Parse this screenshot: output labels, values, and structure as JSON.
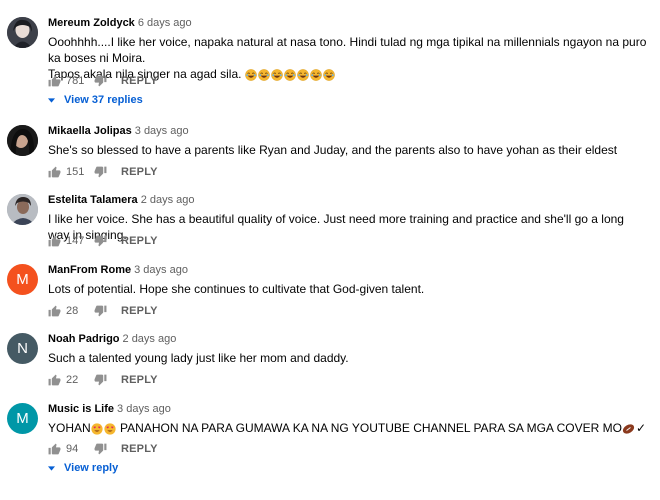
{
  "comments": [
    {
      "author": "Mereum Zoldyck",
      "time": "6 days ago",
      "text": "Ooohhhh....I like her voice, napaka natural at nasa tono. Hindi tulad ng mga tipikal na millennials ngayon na puro ka boses ni Moira.",
      "text2": "Tapos akala nila singer na agad sila.",
      "emoji_count": 7,
      "likes": "781",
      "reply_label": "REPLY",
      "view_replies": "View 37 replies",
      "avatar_type": "photo"
    },
    {
      "author": "Mikaella Jolipas",
      "time": "3 days ago",
      "text": "She's so blessed to have a parents like Ryan and Juday, and the parents also to have yohan as their eldest",
      "likes": "151",
      "reply_label": "REPLY",
      "avatar_type": "photo"
    },
    {
      "author": "Estelita Talamera",
      "time": "2 days ago",
      "text": "I like her voice. She has a beautiful quality of voice. Just need more training and practice and she'll go a long way in singing.",
      "likes": "147",
      "reply_label": "REPLY",
      "avatar_type": "photo"
    },
    {
      "author": "ManFrom Rome",
      "time": "3 days ago",
      "text": "Lots of potential. Hope she  continues to cultivate that God-given talent.",
      "likes": "28",
      "reply_label": "REPLY",
      "avatar_letter": "M",
      "avatar_color": "#f4511e"
    },
    {
      "author": "Noah Padrigo",
      "time": "2 days ago",
      "text": "Such a talented young lady just like her mom and daddy.",
      "likes": "22",
      "reply_label": "REPLY",
      "avatar_letter": "N",
      "avatar_color": "#455a64"
    },
    {
      "author": "Music is Life",
      "time": "3 days ago",
      "text_a": "YOHAN",
      "text_b": "PANAHON NA PARA  GUMAWA KA NA NG YOUTUBE CHANNEL PARA SA MGA COVER MO",
      "text_c": "✓",
      "likes": "94",
      "reply_label": "REPLY",
      "view_replies": "View reply",
      "avatar_letter": "M",
      "avatar_color": "#0097a7"
    }
  ],
  "colors": {
    "link": "#065fd4",
    "secondary": "#606060",
    "primary": "#030303"
  },
  "icons": {
    "like": "thumb-up-icon",
    "dislike": "thumb-down-icon",
    "caret": "caret-down-icon",
    "emoji": "laughing-emoji"
  }
}
